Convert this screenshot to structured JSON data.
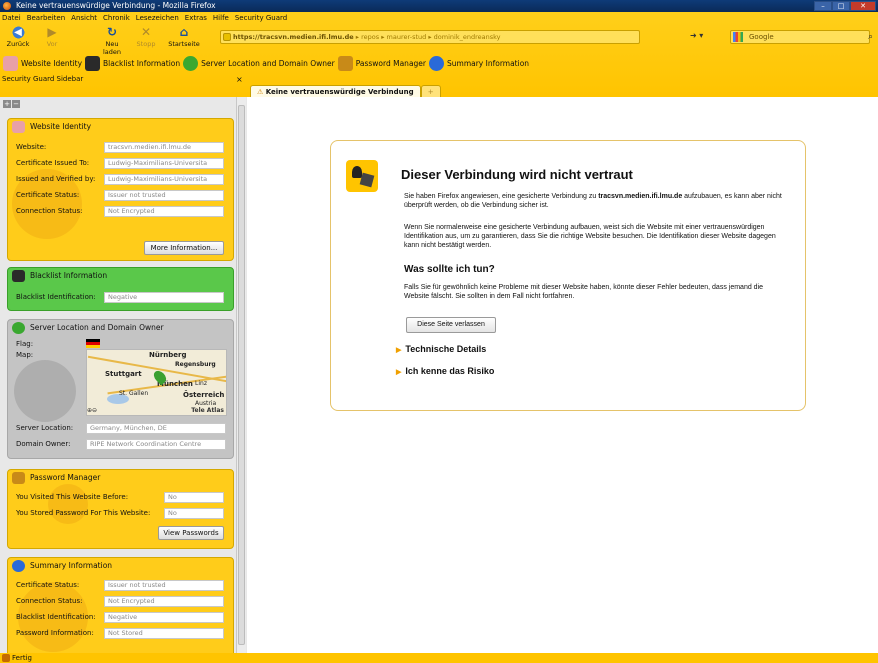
{
  "window": {
    "title": "Keine vertrauenswürdige Verbindung - Mozilla Firefox",
    "buttons": {
      "minimize": "–",
      "maximize": "□",
      "close": "✕"
    }
  },
  "menu": [
    "Datei",
    "Bearbeiten",
    "Ansicht",
    "Chronik",
    "Lesezeichen",
    "Extras",
    "Hilfe",
    "Security Guard"
  ],
  "nav": {
    "back": "Zurück",
    "forward": "Vor",
    "reload": "Neu laden",
    "stop": "Stopp",
    "home": "Startseite",
    "url_host": "https://tracsvn.medien.ifi.lmu.de",
    "url_path": " ▸ repos ▸ maurer-stud ▸ dominik_endreansky",
    "search_engine": "Google",
    "search_placeholder": "Google"
  },
  "sg_toolbar": [
    "Website Identity",
    "Blacklist Information",
    "Server Location and Domain Owner",
    "Password Manager",
    "Summary Information"
  ],
  "sidebar": {
    "header": "Security Guard Sidebar",
    "close": "×",
    "website_identity": {
      "title": "Website Identity",
      "rows": [
        {
          "label": "Website:",
          "value": "tracsvn.medien.ifi.lmu.de"
        },
        {
          "label": "Certificate Issued To:",
          "value": "Ludwig-Maximilians-Universita"
        },
        {
          "label": "Issued and Verified by:",
          "value": "Ludwig-Maximilians-Universita"
        },
        {
          "label": "Certificate Status:",
          "value": "Issuer not trusted"
        },
        {
          "label": "Connection Status:",
          "value": "Not Encrypted"
        }
      ],
      "button": "More Information..."
    },
    "blacklist": {
      "title": "Blacklist Information",
      "label": "Blacklist Identification:",
      "value": "Negative"
    },
    "server": {
      "title": "Server Location and Domain Owner",
      "flag_label": "Flag:",
      "map_label": "Map:",
      "map_cities": [
        "Nürnberg",
        "Regensburg",
        "Stuttgart",
        "München",
        "Österreich",
        "Austria",
        "St. Gallen",
        "Linz"
      ],
      "map_credit": "Tele Atlas",
      "location_label": "Server Location:",
      "location_value": "Germany, München, DE",
      "owner_label": "Domain Owner:",
      "owner_value": "RIPE Network Coordination Centre"
    },
    "password": {
      "title": "Password Manager",
      "visited_label": "You Visited This Website Before:",
      "visited_value": "No",
      "stored_label": "You Stored Password For This Website:",
      "stored_value": "No",
      "button": "View Passwords"
    },
    "summary": {
      "title": "Summary Information",
      "rows": [
        {
          "label": "Certificate Status:",
          "value": "Issuer not trusted"
        },
        {
          "label": "Connection Status:",
          "value": "Not Encrypted"
        },
        {
          "label": "Blacklist Identification:",
          "value": "Negative"
        },
        {
          "label": "Password Information:",
          "value": "Not Stored"
        }
      ]
    }
  },
  "tab": {
    "title": "Keine vertrauenswürdige Verbindung",
    "new": "+"
  },
  "error_page": {
    "title": "Dieser Verbindung wird nicht vertraut",
    "p1_pre": "Sie haben Firefox angewiesen, eine gesicherte Verbindung zu ",
    "p1_host": "tracsvn.medien.ifi.lmu.de",
    "p1_post": " aufzubauen, es kann aber nicht überprüft werden, ob die Verbindung sicher ist.",
    "p2": "Wenn Sie normalerweise eine gesicherte Verbindung aufbauen, weist sich die Website mit einer vertrauenswürdigen Identifikation aus, um zu garantieren, dass Sie die richtige Website besuchen. Die Identifikation dieser Website dagegen kann nicht bestätigt werden.",
    "what_title": "Was sollte ich tun?",
    "p3": "Falls Sie für gewöhnlich keine Probleme mit dieser Website haben, könnte dieser Fehler bedeuten, dass jemand die Website fälscht. Sie sollten in dem Fall nicht fortfahren.",
    "leave_button": "Diese Seite verlassen",
    "technical": "Technische Details",
    "risk": "Ich kenne das Risiko"
  },
  "status": "Fertig",
  "colors": {
    "chrome": "#ffc400",
    "identity_panel": "#ffcc1a",
    "blacklist_panel": "#5ac84a",
    "server_panel": "#c4c4c4"
  }
}
